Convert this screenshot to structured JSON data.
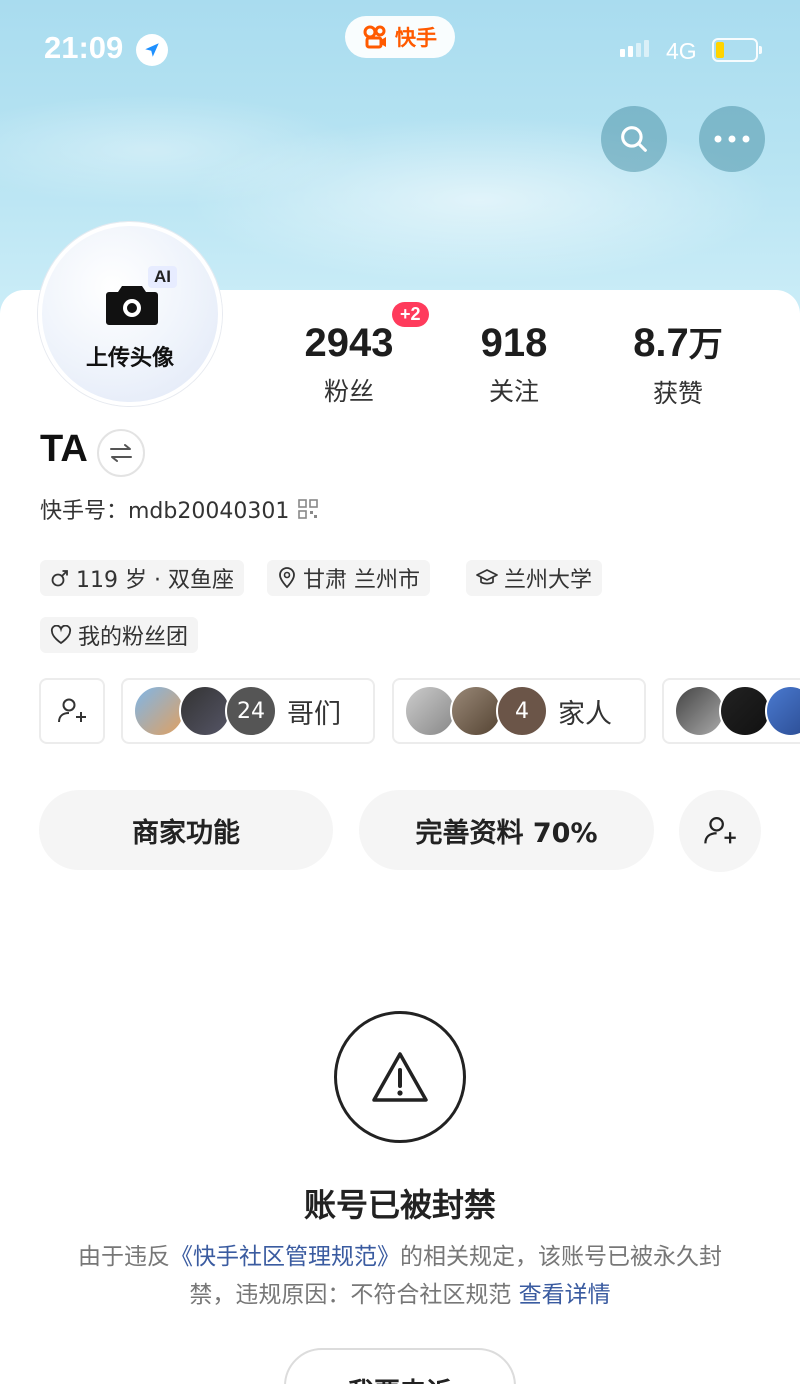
{
  "status_bar": {
    "time": "21:09",
    "network": "4G",
    "battery_color": "#ffd400"
  },
  "app": {
    "name": "快手",
    "brand_color": "#ff5a00"
  },
  "avatar": {
    "badge": "AI",
    "label": "上传头像"
  },
  "stats": [
    {
      "value": "2943",
      "label": "粉丝",
      "badge": "+2"
    },
    {
      "value": "918",
      "label": "关注"
    },
    {
      "value": "8.7",
      "unit": "万",
      "label": "获赞"
    }
  ],
  "profile": {
    "name": "TA",
    "kuaishou_id": "快手号：mdb20040301"
  },
  "tags": [
    {
      "icon": "male-icon",
      "text": "119 岁 · 双鱼座"
    },
    {
      "icon": "location-pin-icon",
      "text": "甘肃 兰州市"
    },
    {
      "icon": "school-icon",
      "text": "兰州大学"
    },
    {
      "icon": "heart-icon",
      "text": "我的粉丝团"
    }
  ],
  "groups": [
    {
      "label": "哥们",
      "count": "24"
    },
    {
      "label": "家人",
      "count": "4"
    }
  ],
  "actions": {
    "merchant": "商家功能",
    "complete_profile": "完善资料 70%"
  },
  "ban": {
    "title": "账号已被封禁",
    "desc_prefix": "由于违反",
    "desc_link": "《快手社区管理规范》",
    "desc_middle": "的相关规定，该账号已被永久封禁，违规原因：不符合社区规范 ",
    "detail_link": "查看详情",
    "appeal_button": "我要申诉"
  }
}
